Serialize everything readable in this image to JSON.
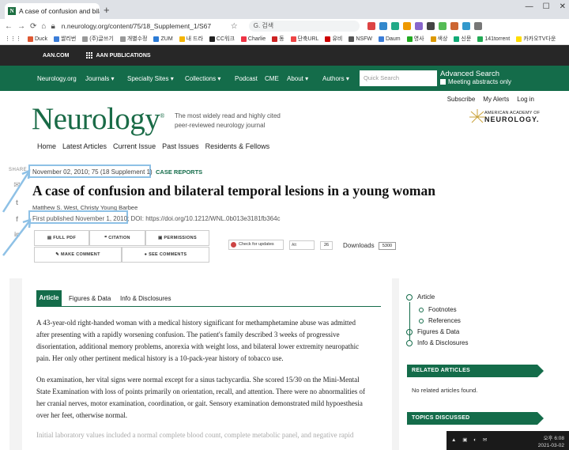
{
  "browser": {
    "tab_title": "A case of confusion and bilateral",
    "favicon_letter": "N",
    "url": "n.neurology.org/content/75/18_Supplement_1/S67",
    "search_placeholder": "G. 검색",
    "bookmarks": [
      {
        "label": "Duck",
        "color": "#de5833"
      },
      {
        "label": "쌀리번",
        "color": "#3b7dd8"
      },
      {
        "label": "(주)글쓰기",
        "color": "#999"
      },
      {
        "label": "개별수정",
        "color": "#999"
      },
      {
        "label": "ZUM",
        "color": "#2b7bd6"
      },
      {
        "label": "내 드라",
        "color": "#f4b400"
      },
      {
        "label": "CC워크",
        "color": "#222"
      },
      {
        "label": "Charlie",
        "color": "#e34"
      },
      {
        "label": "동",
        "color": "#c22"
      },
      {
        "label": "단축URL",
        "color": "#e44"
      },
      {
        "label": "유비",
        "color": "#c00"
      },
      {
        "label": "NSFW",
        "color": "#555"
      },
      {
        "label": "Daum",
        "color": "#3b7dd8"
      },
      {
        "label": "영사",
        "color": "#2a2"
      },
      {
        "label": "색상",
        "color": "#d90"
      },
      {
        "label": "신문",
        "color": "#1a7"
      },
      {
        "label": "141torrent",
        "color": "#2a5"
      },
      {
        "label": "카카오TV다운",
        "color": "#fd0"
      }
    ]
  },
  "site": {
    "aan_com": "AAN.COM",
    "aan_publications": "AAN PUBLICATIONS",
    "nav": [
      "Neurology.org",
      "Journals",
      "Specialty Sites",
      "Collections",
      "Podcast",
      "CME",
      "About",
      "Authors"
    ],
    "search_placeholder": "Quick Search",
    "advanced_search": "Advanced Search",
    "meeting_abstracts": "Meeting abstracts only",
    "top_links": [
      "Subscribe",
      "My Alerts",
      "Log in"
    ],
    "logo_text": "Neurology",
    "logo_reg": "®",
    "tagline": "The most widely read and highly cited peer-reviewed neurology journal",
    "aan_logo_line1": "AMERICAN ACADEMY OF",
    "aan_logo_line2": "NEUROLOGY.",
    "menu": [
      "Home",
      "Latest Articles",
      "Current Issue",
      "Past Issues",
      "Residents & Fellows"
    ]
  },
  "article": {
    "share_label": "SHARE",
    "date_line": "November 02, 2010; 75 (18 Supplement 1)",
    "category": "CASE REPORTS",
    "title": "A case of confusion and bilateral temporal lesions in a young woman",
    "authors": "Matthew S. West, Christy Young Barbee",
    "first_published": "First published November 1, 2010;",
    "doi": "DOI: https://doi.org/10.1212/WNL.0b013e3181fb364c",
    "buttons": {
      "full_pdf": "FULL PDF",
      "citation": "CITATION",
      "permissions": "PERMISSIONS",
      "make_comment": "MAKE COMMENT",
      "see_comments": "SEE COMMENTS"
    },
    "check_updates": "Check for updates",
    "altmetric_label": "Alt",
    "altmetric_score": "26",
    "downloads_label": "Downloads",
    "downloads_count": "5300",
    "tabs": [
      "Article",
      "Figures & Data",
      "Info & Disclosures"
    ],
    "paragraphs": [
      "A 43-year-old right-handed woman with a medical history significant for methamphetamine abuse was admitted after presenting with a rapidly worsening confusion. The patient's family described 3 weeks of progressive disorientation, additional memory problems, anorexia with weight loss, and bilateral lower extremity neuropathic pain. Her only other pertinent medical history is a 10-pack-year history of tobacco use.",
      "On examination, her vital signs were normal except for a sinus tachycardia. She scored 15/30 on the Mini-Mental State Examination with loss of points primarily on orientation, recall, and attention. There were no abnormalities of her cranial nerves, motor examination, coordination, or gait. Sensory examination demonstrated mild hypoesthesia over her feet, otherwise normal."
    ],
    "faded_text": "Initial laboratory values included a normal complete blood count, complete metabolic panel, and negative rapid"
  },
  "sidebar": {
    "toc": [
      "Article",
      "Footnotes",
      "References",
      "Figures & Data",
      "Info & Disclosures"
    ],
    "related_header": "RELATED ARTICLES",
    "related_empty": "No related articles found.",
    "topics_header": "TOPICS DISCUSSED"
  },
  "taskbar": {
    "time": "오후 6:08",
    "date": "2021-03-02"
  },
  "colors": {
    "brand_green": "#146c4a",
    "annotation_blue": "#8ec1e6"
  }
}
